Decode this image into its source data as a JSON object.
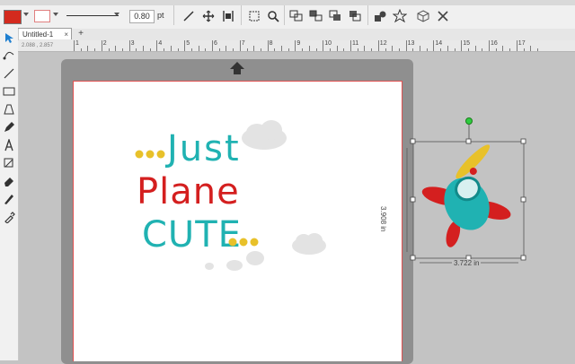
{
  "toolbar": {
    "line_width": "0.80",
    "line_unit": "pt",
    "colors": {
      "fill": "#d42a1e",
      "line": "#e8a0a0"
    }
  },
  "tabs": [
    {
      "label": "Untitled-1",
      "close": "×"
    }
  ],
  "add_tab": "+",
  "ruler": {
    "coords": "2.088 , 2.857",
    "ticks": [
      "1",
      "2",
      "3",
      "4",
      "5",
      "6",
      "7",
      "8",
      "9",
      "10",
      "11",
      "12",
      "13",
      "14",
      "15",
      "16",
      "17"
    ]
  },
  "design": {
    "line1": "Just",
    "line2": "Plane",
    "line3": "CUTE",
    "teal": "#20b2b2",
    "red": "#d41f1f",
    "yellow": "#e8c12a"
  },
  "selection": {
    "height_label": "3.908 in",
    "width_label": "3.722 in"
  }
}
